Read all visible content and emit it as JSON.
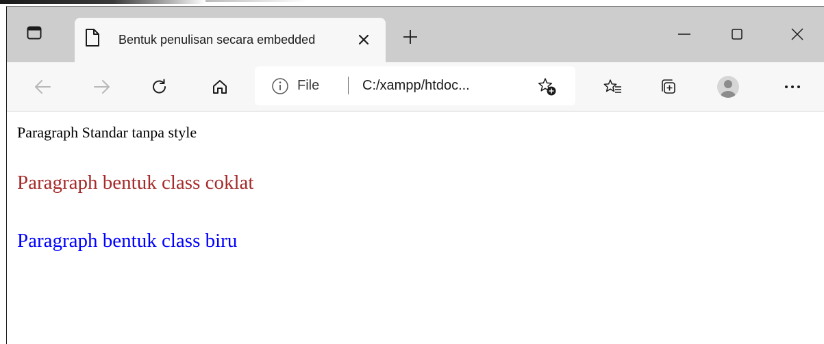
{
  "browser": {
    "tab": {
      "title": "Bentuk penulisan secara embedded",
      "close_icon": "close-icon"
    },
    "new_tab_icon": "plus-icon",
    "window_controls": {
      "minimize_icon": "minimize-icon",
      "maximize_icon": "maximize-icon",
      "close_icon": "close-icon"
    },
    "toolbar": {
      "back_icon": "arrow-left-icon",
      "forward_icon": "arrow-right-icon",
      "refresh_icon": "refresh-icon",
      "home_icon": "home-icon",
      "favorites_add_icon": "star-add-icon",
      "favorites_icon": "favorites-list-icon",
      "collections_icon": "collections-icon",
      "profile_icon": "profile-avatar-icon",
      "more_icon": "ellipsis-icon"
    },
    "address": {
      "scheme_label": "File",
      "url": "C:/xampp/htdoc..."
    }
  },
  "page": {
    "paragraphs": [
      {
        "text": "Paragraph Standar tanpa style",
        "color": "#000000"
      },
      {
        "text": "Paragraph bentuk class coklat",
        "color": "#a52a2a"
      },
      {
        "text": "Paragraph bentuk class biru",
        "color": "#0000ff"
      }
    ]
  }
}
